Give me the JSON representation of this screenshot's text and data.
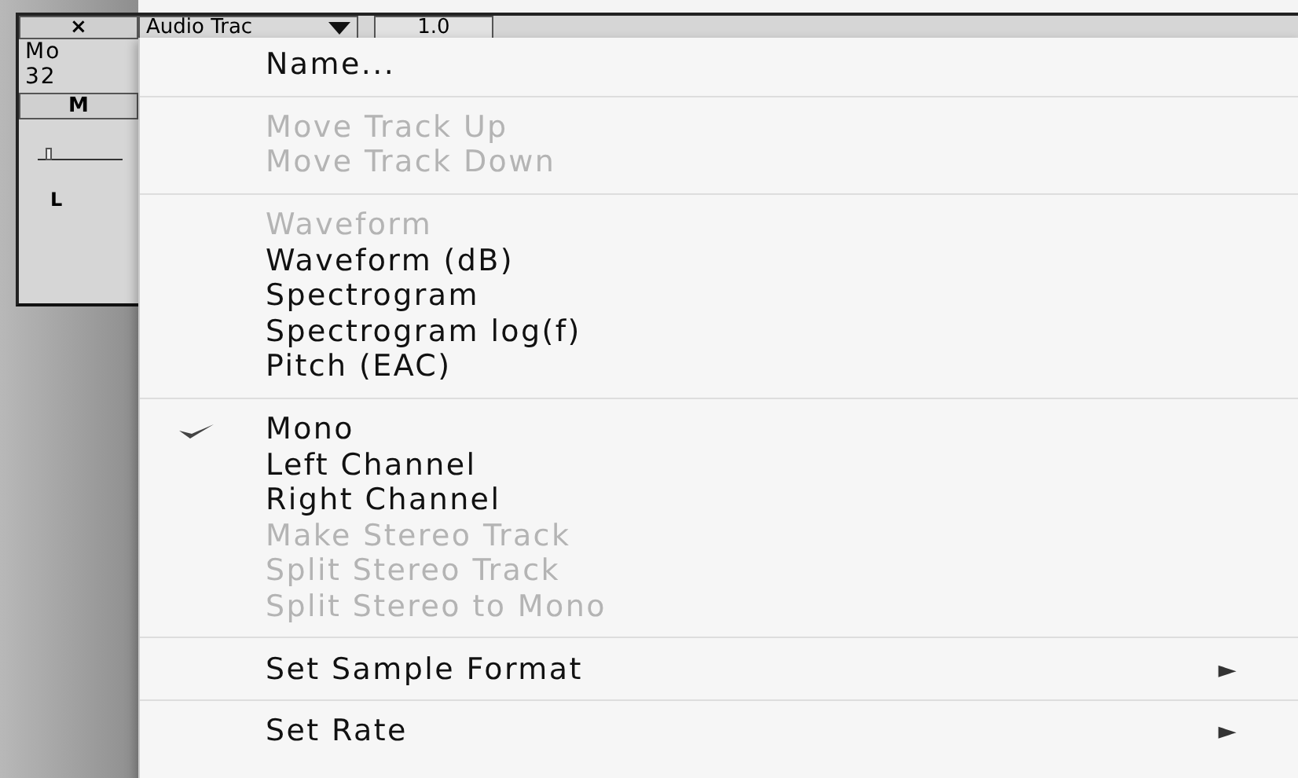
{
  "track": {
    "close": "×",
    "name": "Audio Trac",
    "rate": "1.0",
    "info": [
      "Mo",
      "32"
    ],
    "mute": "M",
    "gain": {
      "level": 0.1
    },
    "pan_label": "L"
  },
  "menu": [
    {
      "kind": "item",
      "label": "Name...",
      "disabled": false,
      "checked": false
    },
    {
      "kind": "separator"
    },
    {
      "kind": "item",
      "label": "Move Track Up",
      "disabled": true,
      "checked": false
    },
    {
      "kind": "item",
      "label": "Move Track Down",
      "disabled": true,
      "checked": false
    },
    {
      "kind": "separator"
    },
    {
      "kind": "item",
      "label": "Waveform",
      "disabled": true,
      "checked": false
    },
    {
      "kind": "item",
      "label": "Waveform (dB)",
      "disabled": false,
      "checked": false
    },
    {
      "kind": "item",
      "label": "Spectrogram",
      "disabled": false,
      "checked": false
    },
    {
      "kind": "item",
      "label": "Spectrogram log(f)",
      "disabled": false,
      "checked": false
    },
    {
      "kind": "item",
      "label": "Pitch (EAC)",
      "disabled": false,
      "checked": false
    },
    {
      "kind": "separator"
    },
    {
      "kind": "item",
      "label": "Mono",
      "disabled": false,
      "checked": true
    },
    {
      "kind": "item",
      "label": "Left Channel",
      "disabled": false,
      "checked": false
    },
    {
      "kind": "item",
      "label": "Right Channel",
      "disabled": false,
      "checked": false
    },
    {
      "kind": "item",
      "label": "Make Stereo Track",
      "disabled": true,
      "checked": false
    },
    {
      "kind": "item",
      "label": "Split Stereo Track",
      "disabled": true,
      "checked": false
    },
    {
      "kind": "item",
      "label": "Split Stereo to Mono",
      "disabled": true,
      "checked": false
    },
    {
      "kind": "separator"
    },
    {
      "kind": "submenu",
      "label": "Set Sample Format",
      "arrow": "►",
      "disabled": false,
      "checked": false
    },
    {
      "kind": "separator"
    },
    {
      "kind": "submenu",
      "label": "Set Rate",
      "arrow": "►",
      "disabled": false,
      "checked": false
    }
  ]
}
